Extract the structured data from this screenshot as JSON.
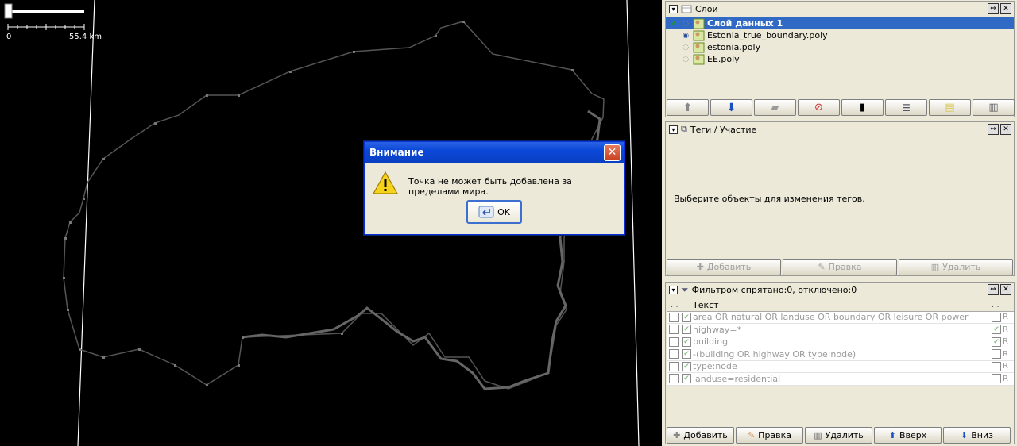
{
  "map": {
    "scale_start": "0",
    "scale_end": "55.4 km"
  },
  "dialog": {
    "title": "Внимание",
    "message": "Точка не может быть добавлена за пределами мира.",
    "ok_label": "OK"
  },
  "layers": {
    "title": "Слои",
    "items": [
      {
        "name": "Слой данных 1"
      },
      {
        "name": "Estonia_true_boundary.poly"
      },
      {
        "name": "estonia.poly"
      },
      {
        "name": "EE.poly"
      }
    ]
  },
  "tags": {
    "title": "Теги / Участие",
    "message": "Выберите объекты для изменения тегов.",
    "add_label": "Добавить",
    "edit_label": "Правка",
    "delete_label": "Удалить"
  },
  "filters": {
    "title": "Фильтром спрятано:0, отключено:0",
    "col_text": "Текст",
    "rows": [
      {
        "text": "area OR natural OR landuse OR boundary OR leisure OR power",
        "r": "R"
      },
      {
        "text": "highway=*",
        "r": "R"
      },
      {
        "text": "building",
        "r": "R"
      },
      {
        "text": "-(building OR highway OR type:node)",
        "r": "R"
      },
      {
        "text": "type:node",
        "r": "R"
      },
      {
        "text": "landuse=residential",
        "r": "R"
      }
    ],
    "add_label": "Добавить",
    "edit_label": "Правка",
    "delete_label": "Удалить",
    "up_label": "Вверх",
    "down_label": "Вниз"
  }
}
